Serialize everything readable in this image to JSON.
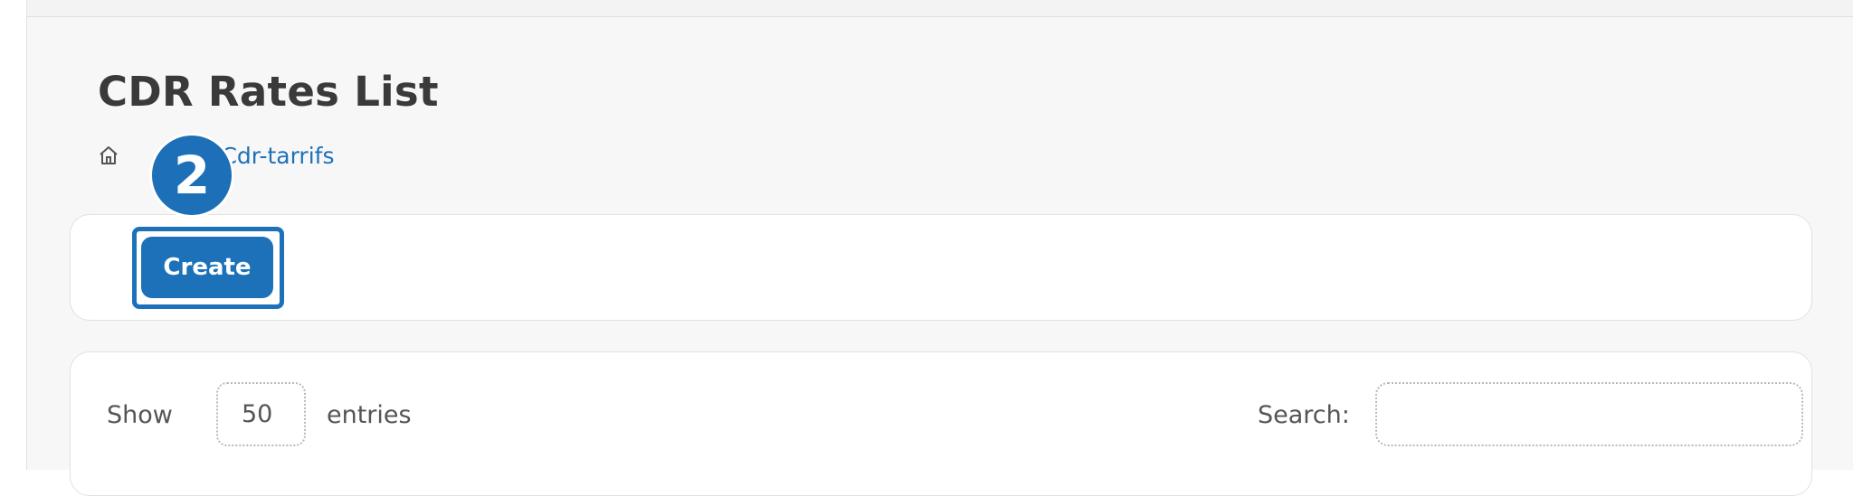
{
  "page": {
    "title": "CDR Rates List"
  },
  "breadcrumb": {
    "home_label": "",
    "separator": "/",
    "current": "Cdr-tarrifs"
  },
  "step_badge": {
    "number": "2"
  },
  "actions": {
    "create_label": "Create"
  },
  "table_controls": {
    "show_label": "Show",
    "entries_value": "50",
    "entries_label": "entries",
    "search_label": "Search:",
    "search_value": ""
  },
  "colors": {
    "accent": "#1c71b9",
    "badge": "#1d6fb8",
    "background": "#f7f7f7"
  },
  "icons": {
    "home": "home-icon"
  }
}
